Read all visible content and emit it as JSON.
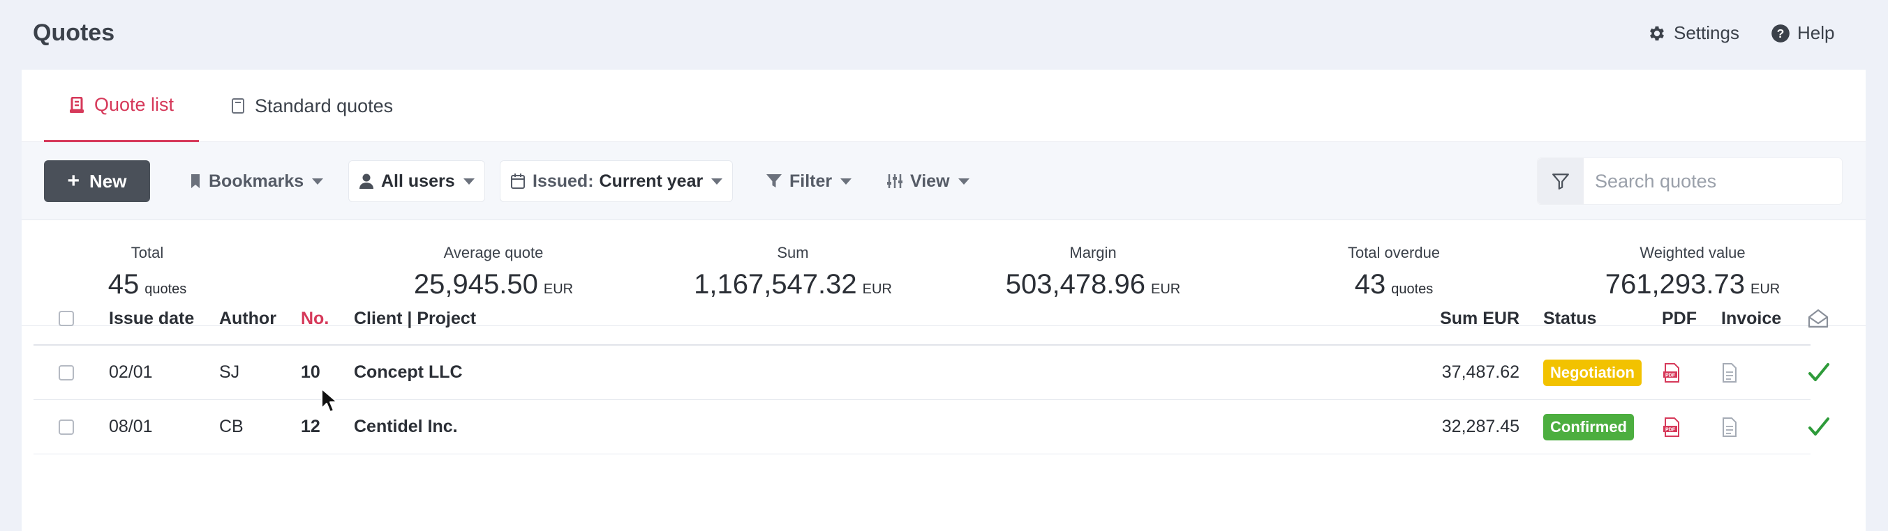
{
  "header": {
    "title": "Quotes",
    "settings_label": "Settings",
    "help_label": "Help"
  },
  "tabs": [
    {
      "label": "Quote list",
      "active": true,
      "icon": "quote-list-icon"
    },
    {
      "label": "Standard quotes",
      "active": false,
      "icon": "document-icon"
    }
  ],
  "toolbar": {
    "new_label": "New",
    "bookmarks_label": "Bookmarks",
    "users_label": "All users",
    "issued_label": "Issued:",
    "issued_value": "Current year",
    "filter_label": "Filter",
    "view_label": "View",
    "search_placeholder": "Search quotes"
  },
  "stats": [
    {
      "label": "Total",
      "value": "45",
      "unit": "quotes"
    },
    {
      "label": "Average quote",
      "value": "25,945.50",
      "unit": "EUR"
    },
    {
      "label": "Sum",
      "value": "1,167,547.32",
      "unit": "EUR"
    },
    {
      "label": "Margin",
      "value": "503,478.96",
      "unit": "EUR"
    },
    {
      "label": "Total overdue",
      "value": "43",
      "unit": "quotes"
    },
    {
      "label": "Weighted value",
      "value": "761,293.73",
      "unit": "EUR"
    }
  ],
  "table": {
    "columns": {
      "issue_date": "Issue date",
      "author": "Author",
      "no": "No.",
      "client": "Client | Project",
      "sum": "Sum EUR",
      "status": "Status",
      "pdf": "PDF",
      "invoice": "Invoice"
    },
    "rows": [
      {
        "issue_date": "02/01",
        "author": "SJ",
        "no": "10",
        "client": "Concept LLC",
        "sum": "37,487.62",
        "status": "Negotiation"
      },
      {
        "issue_date": "08/01",
        "author": "CB",
        "no": "12",
        "client": "Centidel Inc.",
        "sum": "32,287.45",
        "status": "Confirmed"
      }
    ]
  },
  "colors": {
    "accent": "#d6395a",
    "negotiation": "#f2c200",
    "confirmed": "#4cae3f",
    "check": "#2e9b3a"
  }
}
